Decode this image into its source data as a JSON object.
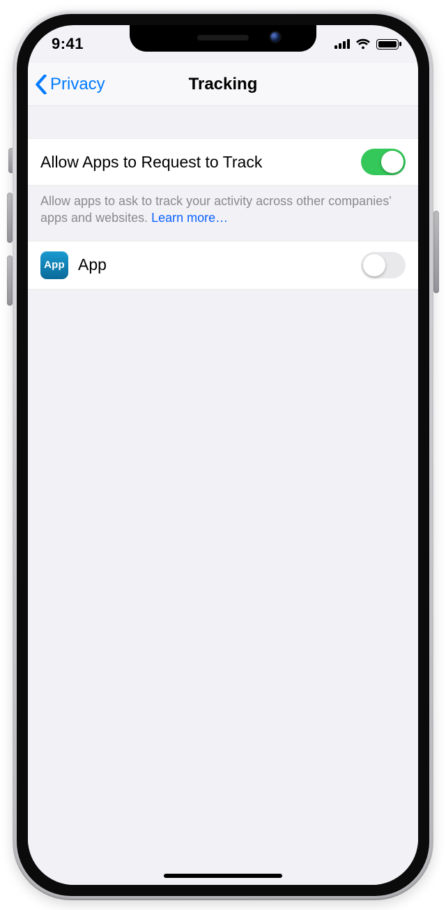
{
  "status": {
    "time": "9:41"
  },
  "nav": {
    "back_label": "Privacy",
    "title": "Tracking"
  },
  "settings": {
    "allow_row_label": "Allow Apps to Request to Track",
    "allow_on": true,
    "footer_text": "Allow apps to ask to track your activity across other companies' apps and websites. ",
    "learn_more": "Learn more…"
  },
  "apps": [
    {
      "name": "App",
      "icon_text": "App",
      "on": false
    }
  ]
}
